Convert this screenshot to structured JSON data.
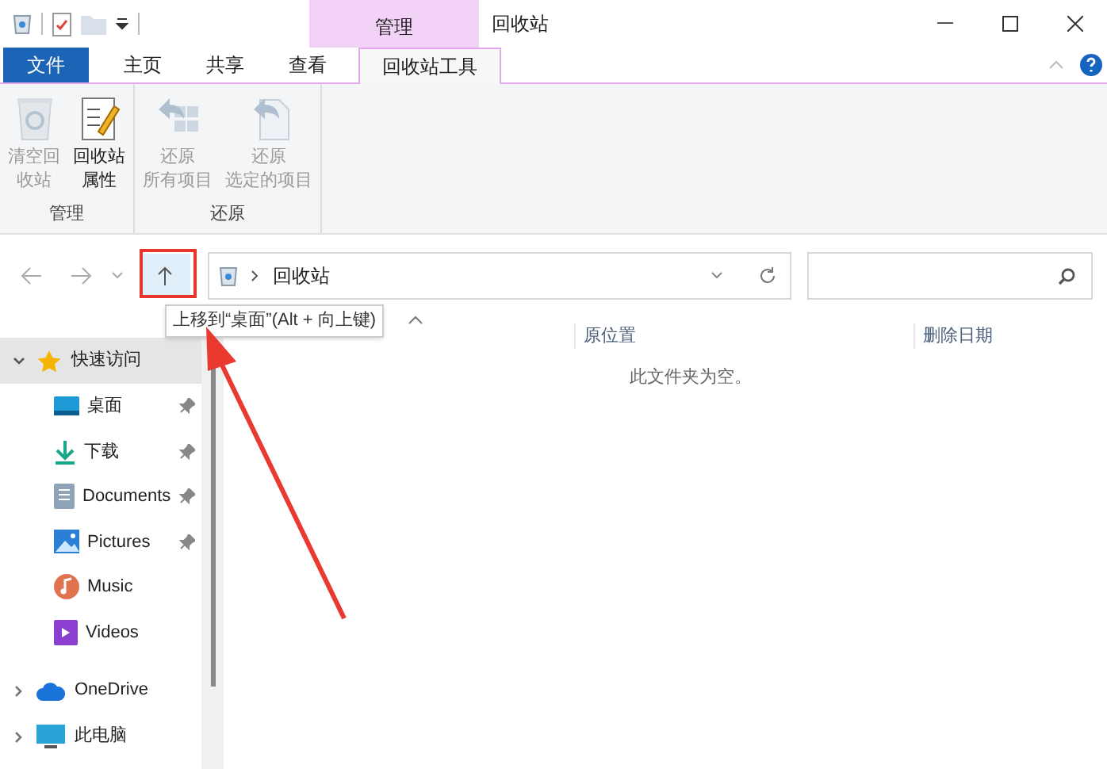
{
  "title_bar": {
    "contextual_group": "管理",
    "title": "回收站"
  },
  "ribbon_tabs": [
    {
      "label": "文件",
      "kind": "file",
      "selected": false
    },
    {
      "label": "主页",
      "kind": "tab",
      "selected": false
    },
    {
      "label": "共享",
      "kind": "tab",
      "selected": false
    },
    {
      "label": "查看",
      "kind": "tab",
      "selected": false
    },
    {
      "label": "回收站工具",
      "kind": "contextual",
      "selected": true
    }
  ],
  "ribbon_groups": [
    {
      "label": "管理",
      "buttons": [
        {
          "lines": [
            "清空回",
            "收站"
          ],
          "kind": "recycle-bin",
          "disabled": true
        },
        {
          "lines": [
            "回收站",
            "属性"
          ],
          "kind": "properties",
          "disabled": false
        }
      ]
    },
    {
      "label": "还原",
      "buttons": [
        {
          "lines": [
            "还原",
            "所有项目"
          ],
          "kind": "restore-all",
          "disabled": true
        },
        {
          "lines": [
            "还原",
            "选定的项目"
          ],
          "kind": "restore-selected",
          "disabled": true
        }
      ]
    }
  ],
  "address_bar": {
    "path": "回收站"
  },
  "tooltip": "上移到“桌面”(Alt + 向上键)",
  "columns": [
    {
      "label": "原位置"
    },
    {
      "label": "删除日期"
    }
  ],
  "empty_message": "此文件夹为空。",
  "sidebar": [
    {
      "label": "快速访问",
      "kind": "star",
      "expanded": true,
      "selected": true,
      "children": [
        {
          "label": "桌面",
          "kind": "desktop",
          "pinned": true
        },
        {
          "label": "下载",
          "kind": "download",
          "pinned": true
        },
        {
          "label": "Documents",
          "kind": "documents",
          "pinned": true
        },
        {
          "label": "Pictures",
          "kind": "pictures",
          "pinned": true
        },
        {
          "label": "Music",
          "kind": "music",
          "pinned": false
        },
        {
          "label": "Videos",
          "kind": "videos",
          "pinned": false
        }
      ]
    },
    {
      "label": "OneDrive",
      "kind": "cloud",
      "expanded": false,
      "selected": false
    },
    {
      "label": "此电脑",
      "kind": "pc",
      "expanded": false,
      "selected": false
    }
  ]
}
